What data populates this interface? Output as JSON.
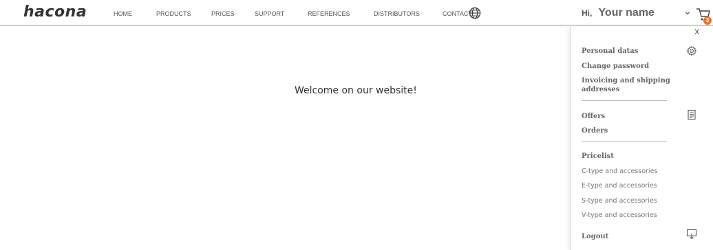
{
  "header": {
    "logo": "hacona",
    "nav": [
      "HOME",
      "PRODUCTS",
      "PRICES",
      "SUPPORT",
      "REFERENCES",
      "DISTRIBUTORS",
      "CONTACT"
    ],
    "greeting_hi": "Hi,",
    "user_name": "Your name",
    "cart_count": "3"
  },
  "main": {
    "welcome": "Welcome on our website!"
  },
  "panel": {
    "close": "X",
    "account": {
      "personal": "Personal datas",
      "password": "Change password",
      "addresses_1": "Invoicing and shipping",
      "addresses_2": "addresses"
    },
    "docs": {
      "offers": "Offers",
      "orders": "Orders"
    },
    "pricelist": {
      "title": "Pricelist",
      "items": [
        "C-type and accessories",
        "E-type and accessories",
        "S-type and accessories",
        "V-type and accessories"
      ]
    },
    "logout": "Logout"
  },
  "icons": {
    "globe": "globe-icon",
    "chevron": "chevron-down-icon",
    "cart": "cart-icon",
    "settings": "gear-icon",
    "documents": "document-icon",
    "download": "download-icon"
  },
  "colors": {
    "badge": "#e8762c",
    "text": "#444444"
  }
}
